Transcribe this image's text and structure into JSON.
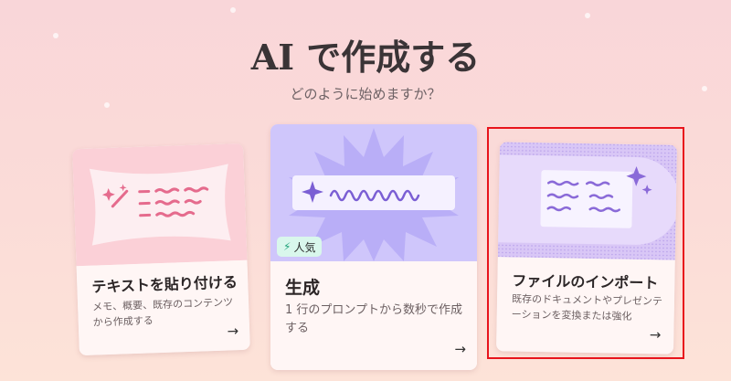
{
  "header": {
    "title": "AI で作成する",
    "subtitle": "どのように始めますか？"
  },
  "cards": [
    {
      "title": "テキストを貼り付ける",
      "description": "メモ、概要、既存のコンテンツから作成する",
      "arrow": "→",
      "icon": "magic-wand-icon"
    },
    {
      "title": "生成",
      "description": "1 行のプロンプトから数秒で作成する",
      "arrow": "→",
      "badge": "人気",
      "badge_icon": "lightning-icon",
      "icon": "sparkle-icon"
    },
    {
      "title": "ファイルのインポート",
      "description": "既存のドキュメントやプレゼンテーションを変換または強化",
      "arrow": "→",
      "icon": "document-import-icon",
      "selected": true
    }
  ],
  "colors": {
    "background": "#f9d6d9",
    "card1_art": "#fbd0d7",
    "card2_art": "#cfc6fb",
    "card3_art": "#d9c7f6",
    "badge_bg": "#d9f7ec",
    "selection": "#e8141c",
    "scribble_pink": "#e56b8d",
    "scribble_purple": "#8a6ad8"
  }
}
